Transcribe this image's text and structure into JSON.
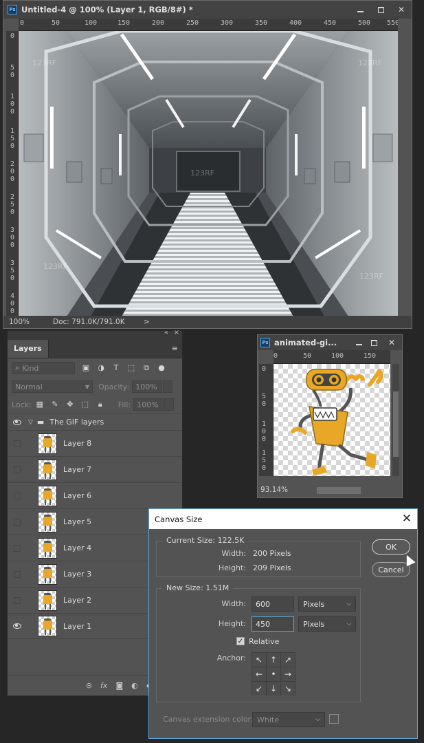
{
  "main_window": {
    "title": "Untitled-4 @ 100% (Layer 1, RGB/8#) *",
    "ruler_h": [
      "0",
      "50",
      "100",
      "150",
      "200",
      "250",
      "300",
      "350",
      "400",
      "450",
      "500",
      "550"
    ],
    "ruler_v": [
      "0",
      "50",
      "100",
      "150",
      "200",
      "250",
      "300",
      "350",
      "400"
    ],
    "zoom": "100%",
    "doc_info": "Doc: 791.0K/791.0K",
    "status_arrow": ">",
    "watermark": "123RF"
  },
  "layers_panel": {
    "collapse": "«",
    "close": "×",
    "tab_label": "Layers",
    "menu_icon": "≡",
    "kind_label": "Kind",
    "blend_mode": "Normal",
    "opacity_label": "Opacity:",
    "opacity_value": "100%",
    "lock_label": "Lock:",
    "fill_label": "Fill:",
    "fill_value": "100%",
    "group": {
      "name": "The GIF layers",
      "visible": true
    },
    "layers": [
      {
        "name": "Layer 8",
        "visible": false
      },
      {
        "name": "Layer 7",
        "visible": false
      },
      {
        "name": "Layer 6",
        "visible": false
      },
      {
        "name": "Layer 5",
        "visible": false
      },
      {
        "name": "Layer 4",
        "visible": false
      },
      {
        "name": "Layer 3",
        "visible": false
      },
      {
        "name": "Layer 2",
        "visible": false
      },
      {
        "name": "Layer 1",
        "visible": true
      }
    ],
    "bottom_icons": [
      "link-icon",
      "fx-icon",
      "mask-icon",
      "adjustment-icon",
      "folder-icon",
      "new-layer-icon"
    ]
  },
  "gif_window": {
    "title": "animated-gi...",
    "ruler_h": [
      "0",
      "50",
      "100",
      "150"
    ],
    "ruler_v": [
      "0",
      "50",
      "100",
      "150"
    ],
    "zoom": "93.14%"
  },
  "canvas_size_dialog": {
    "title": "Canvas Size",
    "close": "✕",
    "current_size": {
      "legend": "Current Size: 122.5K",
      "width_label": "Width:",
      "width_value": "200 Pixels",
      "height_label": "Height:",
      "height_value": "209 Pixels"
    },
    "new_size": {
      "legend": "New Size: 1.51M",
      "width_label": "Width:",
      "width_value": "600",
      "width_unit": "Pixels",
      "height_label": "Height:",
      "height_value": "450",
      "height_unit": "Pixels",
      "relative_label": "Relative",
      "relative_checked": true,
      "anchor_label": "Anchor:",
      "anchor_arrows": [
        "↖",
        "↑",
        "↗",
        "←",
        "•",
        "→",
        "↙",
        "↓",
        "↘"
      ]
    },
    "extension_color_label": "Canvas extension color:",
    "extension_color_value": "White",
    "ok_label": "OK",
    "cancel_label": "Cancel",
    "accent_color": "#5aa6d8",
    "robot_color": "#e8a727"
  }
}
